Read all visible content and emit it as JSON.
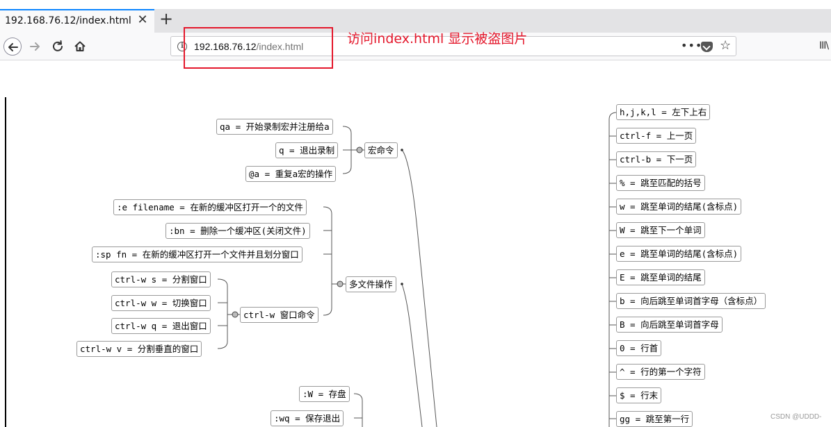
{
  "browser": {
    "tab": {
      "title": "192.168.76.12/index.html",
      "close_glyph": "✕"
    },
    "new_tab_glyph": "+",
    "url": {
      "host": "192.168.76.12",
      "path": "/index.html"
    },
    "page_actions_glyph": "•••",
    "bookmark_glyph": "☆",
    "library_glyph": "III\\"
  },
  "annotation": {
    "text": "访问index.html 显示被盗图片",
    "color": "#e4172b"
  },
  "mindmap": {
    "macro": {
      "label": "宏命令",
      "children": [
        "qa = 开始录制宏并注册给a",
        "q = 退出录制",
        "@a = 重复a宏的操作"
      ]
    },
    "multifile": {
      "label": "多文件操作",
      "children": [
        ":e filename = 在新的缓冲区打开一个的文件",
        ":bn = 删除一个缓冲区(关闭文件)",
        ":sp fn = 在新的缓冲区打开一个文件并且划分窗口"
      ],
      "ctrlw": {
        "label": "ctrl-w 窗口命令",
        "children": [
          "ctrl-w s = 分割窗口",
          "ctrl-w w = 切换窗口",
          "ctrl-w q = 退出窗口",
          "ctrl-w v = 分割垂直的窗口"
        ]
      }
    },
    "save": [
      ":W = 存盘",
      ":wq = 保存退出"
    ],
    "movement": [
      "h,j,k,l = 左下上右",
      "ctrl-f = 上一页",
      "ctrl-b = 下一页",
      "% = 跳至匹配的括号",
      "w = 跳至单词的结尾(含标点)",
      "W = 跳至下一个单词",
      "e = 跳至单词的结尾(含标点)",
      "E = 跳至单词的结尾",
      "b = 向后跳至单词首字母（含标点）",
      "B = 向后跳至单词首字母",
      "0 = 行首",
      "^ = 行的第一个字符",
      "$ = 行末",
      "gg = 跳至第一行"
    ]
  },
  "watermark": "CSDN @UDDD-"
}
